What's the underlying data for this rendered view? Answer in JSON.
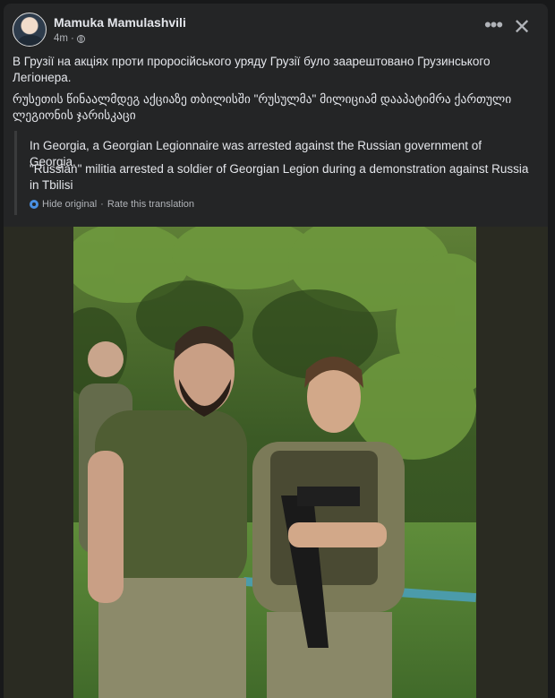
{
  "post": {
    "author": "Mamuka Mamulashvili",
    "time": "4m",
    "more_label": "•••",
    "close_label": "✕",
    "original_ukrainian": "В Грузії на акціях проти проросійського уряду Грузії було заарештовано Грузинського Легіонера.",
    "original_georgian": "რუსეთის წინაალმდეგ აქციაზე  თბილისში \"რუსულმა\" მილიციამ დააპატიმრა ქართული  ლეგიონის ჯარისკაცი",
    "translation_1": "In Georgia, a Georgian Legionnaire was arrested against the Russian government of Georgia.",
    "translation_2": "\"Russian\" militia arrested a soldier of Georgian Legion during a demonstration against Russia in Tbilisi",
    "hide_original": "Hide original",
    "separator": "·",
    "rate_translation": "Rate this translation"
  },
  "icons": {
    "privacy": "globe-icon",
    "translate": "translate-gear-icon",
    "more": "more-options-icon",
    "close": "close-icon"
  }
}
